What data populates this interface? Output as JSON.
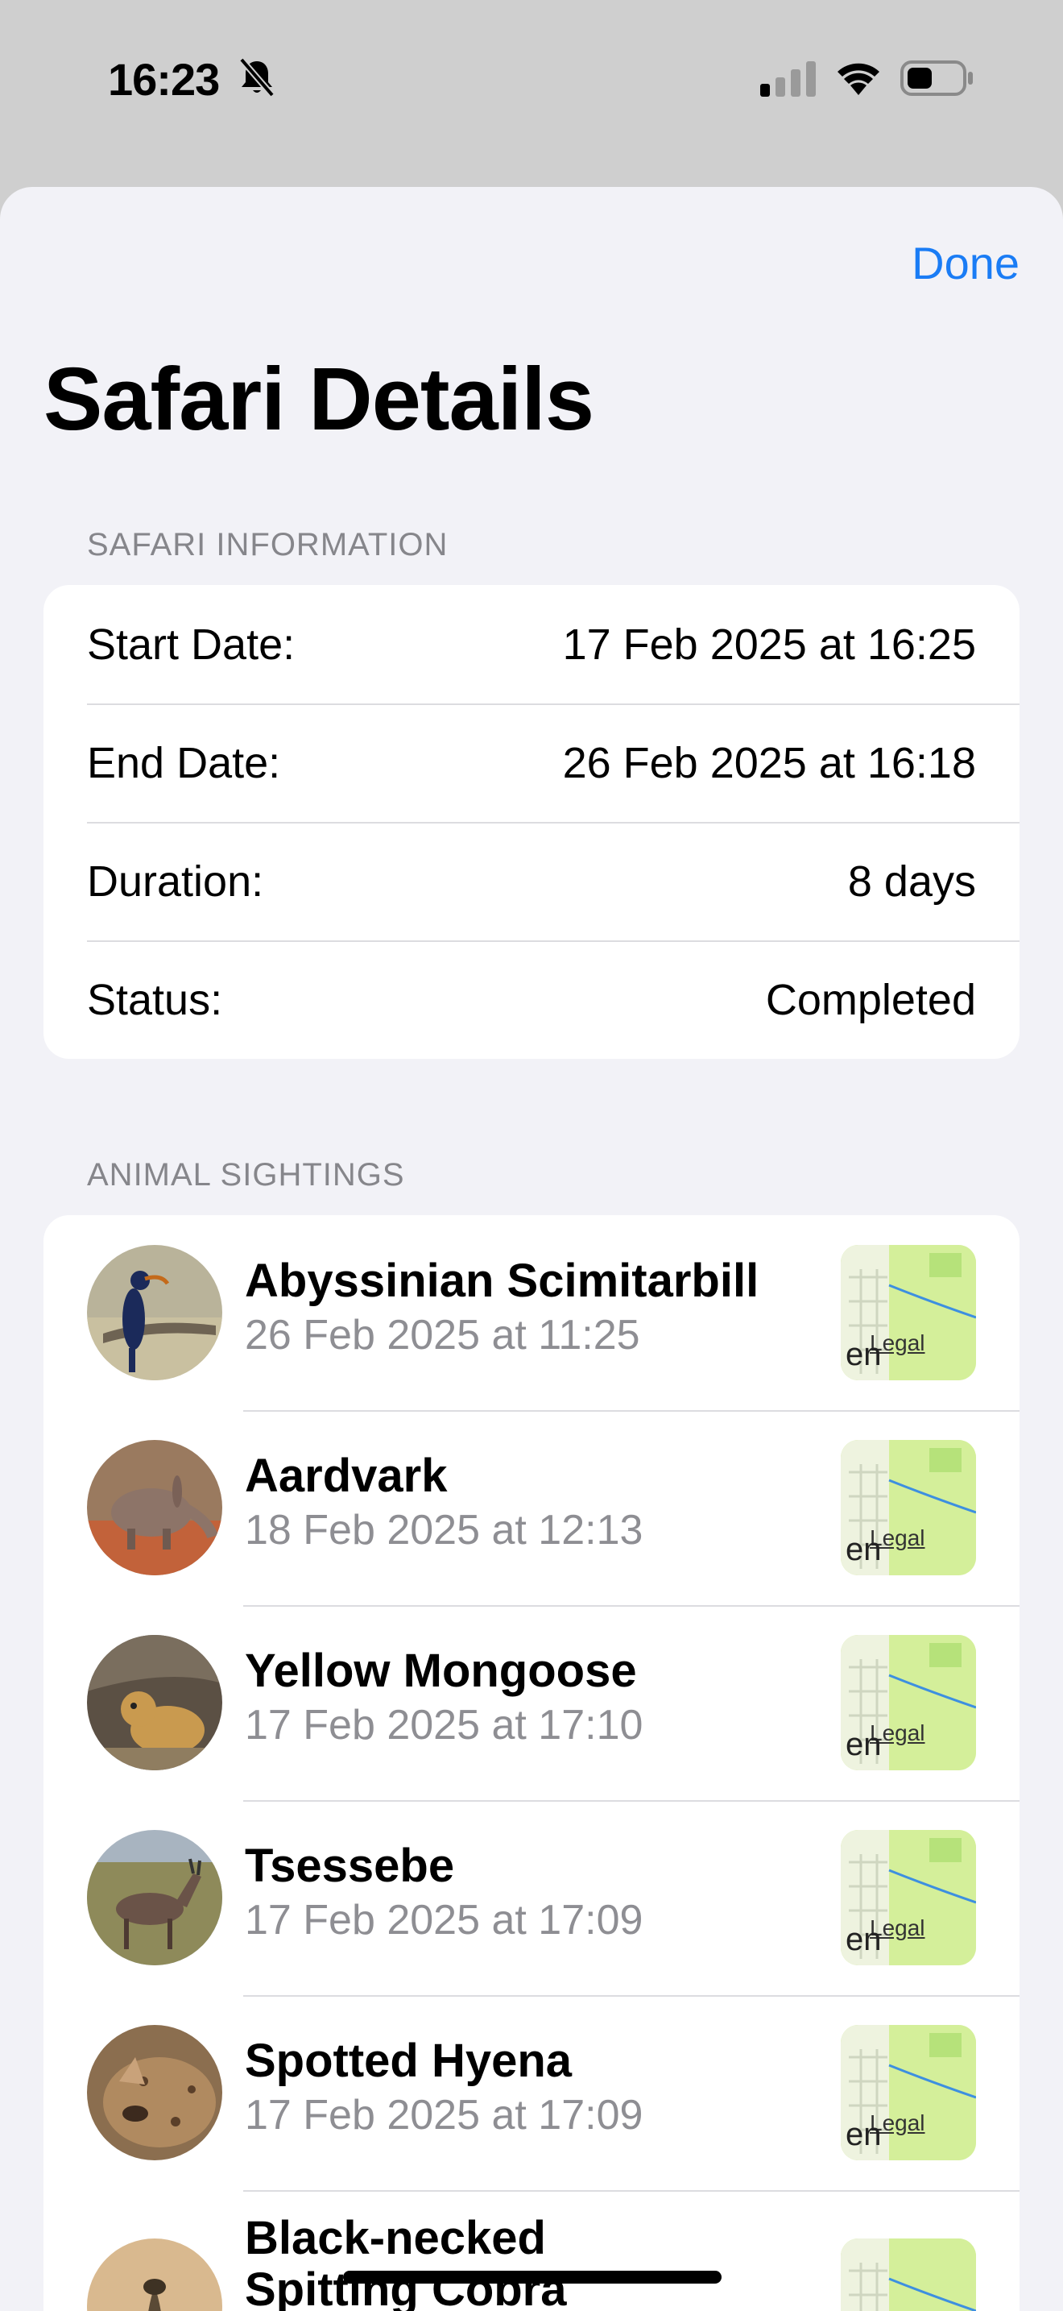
{
  "status_bar": {
    "time": "16:23",
    "icons": [
      "bell-slash-icon",
      "cellular-signal-icon",
      "wifi-icon",
      "battery-icon"
    ]
  },
  "header": {
    "done_label": "Done",
    "title": "Safari Details"
  },
  "safari_information": {
    "header": "SAFARI INFORMATION",
    "rows": [
      {
        "label": "Start Date:",
        "value": "17 Feb 2025 at 16:25"
      },
      {
        "label": "End Date:",
        "value": "26 Feb 2025 at 16:18"
      },
      {
        "label": "Duration:",
        "value": "8 days"
      },
      {
        "label": "Status:",
        "value": "Completed"
      }
    ]
  },
  "animal_sightings": {
    "header": "ANIMAL SIGHTINGS",
    "items": [
      {
        "name": "Abyssinian Scimitarbill",
        "date": "26 Feb 2025 at 11:25",
        "map_legal": "Legal",
        "map_lang": "en"
      },
      {
        "name": "Aardvark",
        "date": "18 Feb 2025 at 12:13",
        "map_legal": "Legal",
        "map_lang": "en"
      },
      {
        "name": "Yellow Mongoose",
        "date": "17 Feb 2025 at 17:10",
        "map_legal": "Legal",
        "map_lang": "en"
      },
      {
        "name": "Tsessebe",
        "date": "17 Feb 2025 at 17:09",
        "map_legal": "Legal",
        "map_lang": "en"
      },
      {
        "name": "Spotted Hyena",
        "date": "17 Feb 2025 at 17:09",
        "map_legal": "Legal",
        "map_lang": "en"
      },
      {
        "name": "Black-necked Spitting Cobra",
        "date": "",
        "map_legal": "",
        "map_lang": ""
      }
    ]
  },
  "colors": {
    "accent": "#1a7cf5",
    "background": "#f2f2f7",
    "secondary_text": "#8e8e93"
  }
}
